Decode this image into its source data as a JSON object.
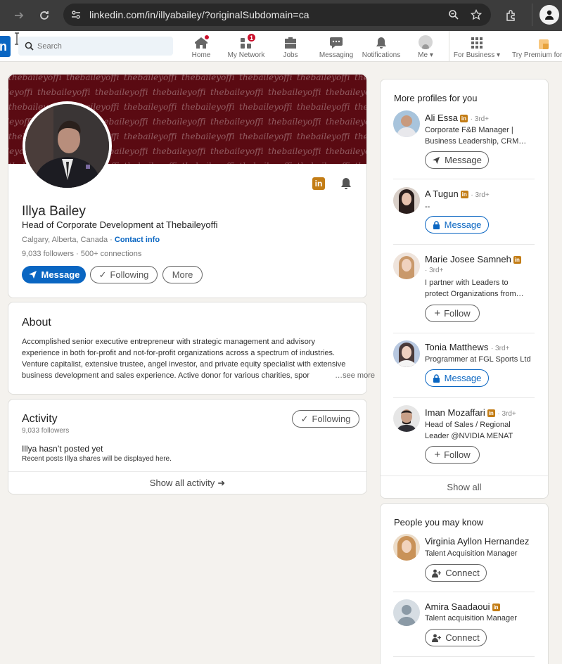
{
  "browser": {
    "url": "linkedin.com/in/illyabailey/?originalSubdomain=ca",
    "icons": [
      "forward-icon",
      "reload-icon",
      "site-info-icon",
      "zoom-icon",
      "bookmark-star-icon",
      "extensions-icon",
      "profile-icon"
    ]
  },
  "nav": {
    "search_placeholder": "Search",
    "items": [
      {
        "label": "Home",
        "icon": "home-icon",
        "badge": ""
      },
      {
        "label": "My Network",
        "icon": "network-icon",
        "badge": "1"
      },
      {
        "label": "Jobs",
        "icon": "jobs-icon",
        "badge": ""
      },
      {
        "label": "Messaging",
        "icon": "messaging-icon",
        "badge": ""
      },
      {
        "label": "Notifications",
        "icon": "bell-icon",
        "badge": ""
      },
      {
        "label": "Me",
        "icon": "avatar-icon",
        "badge": ""
      },
      {
        "label": "For Business",
        "icon": "grid-icon",
        "badge": ""
      },
      {
        "label": "Try Premium for",
        "icon": "premium-icon",
        "badge": ""
      }
    ]
  },
  "profile": {
    "name": "Illya Bailey",
    "headline": "Head of Corporate Development at Thebaileyoffi",
    "location": "Calgary, Alberta, Canada",
    "contact_info": "Contact info",
    "followers": "9,033 followers",
    "connections": "500+ connections",
    "cover_watermark": "thebaileyoffi",
    "buttons": {
      "message": "Message",
      "following": "Following",
      "more": "More"
    }
  },
  "about": {
    "title": "About",
    "lines": [
      "Accomplished senior executive entrepreneur with strategic management and advisory",
      "experience in both for-profit and not-for-profit organizations across a spectrum of industries.",
      "Venture capitalist, extensive trustee, angel investor, and private equity specialist with extensive",
      "business development and sales experience. Active donor for various charities, spor"
    ],
    "see_more": "…see more"
  },
  "activity": {
    "title": "Activity",
    "followers": "9,033 followers",
    "following_button": "Following",
    "empty_title": "Illya hasn’t posted yet",
    "empty_sub": "Recent posts Illya shares will be displayed here.",
    "show_all": "Show all activity"
  },
  "more_profiles": {
    "title": "More profiles for you",
    "show_all": "Show all",
    "people": [
      {
        "name": "Ali Essa",
        "degree": "· 3rd+",
        "lines": [
          "Corporate F&B Manager |",
          "Business Leadership, CRM…"
        ],
        "action": "Message"
      },
      {
        "name": "A Tugun",
        "degree": "· 3rd+",
        "lines": [
          "--"
        ],
        "action": "Message"
      },
      {
        "name": "Marie Josee Samneh",
        "degree": "· 3rd+",
        "lines": [
          "I partner with Leaders to",
          "protect Organizations from…"
        ],
        "action": "Follow"
      },
      {
        "name": "Tonia Matthews",
        "degree": "· 3rd+",
        "lines": [
          "Programmer at FGL Sports Ltd"
        ],
        "action": "Message"
      },
      {
        "name": "Iman Mozaffari",
        "degree": "· 3rd+",
        "lines": [
          "Head of Sales / Regional",
          "Leader @NVIDIA MENAT"
        ],
        "action": "Follow"
      }
    ]
  },
  "people_know": {
    "title": "People you may know",
    "people": [
      {
        "name": "Virginia Ayllon Hernandez",
        "lines": [
          "Talent Acquisition Manager"
        ],
        "action": "Connect"
      },
      {
        "name": "Amira Saadaoui",
        "lines": [
          "Talent acquisition Manager"
        ],
        "action": "Connect"
      }
    ]
  },
  "colors": {
    "brand": "#0a66c2",
    "premium": "#c37d16",
    "cover": "#5a0a12",
    "badge": "#cb112d"
  }
}
